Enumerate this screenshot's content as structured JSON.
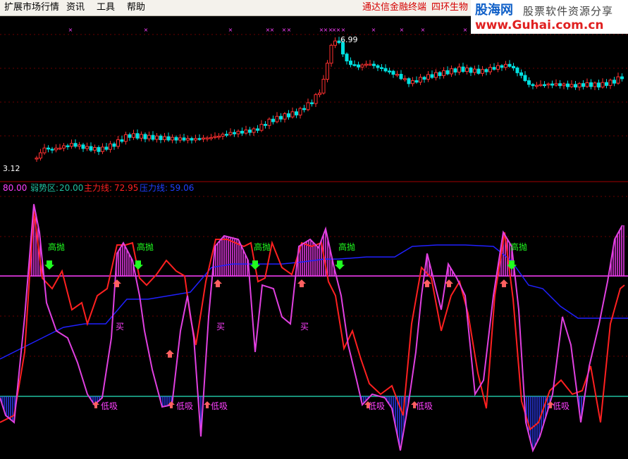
{
  "menu": {
    "items": [
      "扩展市场行情",
      "资讯",
      "工具",
      "帮助"
    ],
    "right": [
      "通达信金融终端",
      "四环生物"
    ]
  },
  "watermark": {
    "logo": "股海网",
    "slogan": "股票软件资源分享",
    "url": "www.Guhai.com.cn"
  },
  "price_panel": {
    "high_label": "6.99",
    "low_label": "3.12"
  },
  "indicator_panel": {
    "legend": {
      "strong_value": "80.00",
      "weak_label": "弱势区:",
      "weak_value": "20.00",
      "main_label": "主力线:",
      "main_value": "72.95",
      "pressure_label": "压力线:",
      "pressure_value": "59.06"
    },
    "signals": {
      "sell": "高抛",
      "buy": "买",
      "bottom": "低吸"
    }
  },
  "colors": {
    "background": "#000000",
    "up": "#ff3030",
    "down": "#00e0e0",
    "main_line": "#ff2020",
    "pressure_line": "#2020ff",
    "indicator_line": "#e040e0",
    "strong_band": "#ff40ff",
    "weak_band": "#20c0a0",
    "sell_text": "#20ff20",
    "buy_text": "#ff40ff"
  }
}
